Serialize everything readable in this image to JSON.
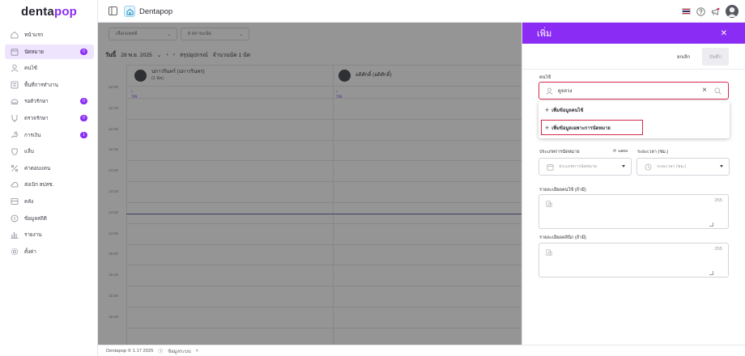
{
  "sidebar": {
    "logo_main": "denta",
    "logo_accent": "pop",
    "items": [
      {
        "label": "หน้าแรก",
        "icon": "home-icon",
        "badge": ""
      },
      {
        "label": "นัดหมาย",
        "icon": "calendar-icon",
        "badge": "0"
      },
      {
        "label": "คนไข้",
        "icon": "user-icon",
        "badge": ""
      },
      {
        "label": "พื้นที่การทำงาน",
        "icon": "workspace-icon",
        "badge": ""
      },
      {
        "label": "รอตัวรักษา",
        "icon": "waiting-icon",
        "badge": "0"
      },
      {
        "label": "ตรวจรักษา",
        "icon": "treatment-icon",
        "badge": "0"
      },
      {
        "label": "การเงิน",
        "icon": "finance-icon",
        "badge": "1"
      },
      {
        "label": "แล็บ",
        "icon": "lab-icon",
        "badge": ""
      },
      {
        "label": "ค่าตอบแทน",
        "icon": "percent-icon",
        "badge": ""
      },
      {
        "label": "ส่งเบิก สปสช.",
        "icon": "cloud-icon",
        "badge": ""
      },
      {
        "label": "คลัง",
        "icon": "inventory-icon",
        "badge": ""
      },
      {
        "label": "ข้อมูลสถิติ",
        "icon": "stats-icon",
        "badge": ""
      },
      {
        "label": "รายงาน",
        "icon": "report-icon",
        "badge": ""
      },
      {
        "label": "ตั้งค่า",
        "icon": "settings-icon",
        "badge": ""
      }
    ]
  },
  "topbar": {
    "brand": "Dentapop"
  },
  "calendar": {
    "filter_location": "เลือกแพทย์",
    "filter_status": "8 สถานะนัด",
    "day_label": "วันนี้",
    "date": "28 พ.ย. 2025",
    "summary": "สรุปอุปกรณ์",
    "count": "จำนวนนัด 1 นัด",
    "columns": [
      {
        "name": "ปภาวรินทร์ (ปภาวรินทร)",
        "sub": "(1 นัด)",
        "day": "28"
      },
      {
        "name": "อดิศักดิ์ (อดิศักดิ์)",
        "sub": "",
        "day": "28"
      }
    ],
    "times": [
      "12:00",
      "12:15",
      "12:30",
      "12:45",
      "14:00",
      "14:15",
      "14:30",
      "14:45",
      "15:00",
      "15:15",
      "15:30",
      "15:45"
    ]
  },
  "footer": {
    "copyright": "Dentapop © 1.17 2025",
    "info": "ข้อมูลระบบ"
  },
  "panel": {
    "title": "เพิ่ม",
    "cancel": "ยกเลิก",
    "save": "บันทึก",
    "patient_label": "คนไข้",
    "search_value": "ดูจลวง",
    "options": [
      "เพิ่มข้อมูลคนไข้",
      "เพิ่มข้อมูลเฉพาะการนัดหมาย"
    ],
    "type_label": "ประเภทการนัดหมาย",
    "refresh_label": "แสดง",
    "duration_label": "ระยะเวลา (ชม.)",
    "type_placeholder": "ประเภทการนัดหมาย",
    "duration_placeholder": "ระยะเวลา (ชม.)",
    "note_patient_label": "รายละเอียดคนไข้ (ถ้ามี)",
    "note_clinic_label": "รายละเอียดคลินิก (ถ้ามี)",
    "note_max": "255"
  },
  "colors": {
    "accent": "#8b2cf5",
    "highlight": "#d42a4c"
  }
}
